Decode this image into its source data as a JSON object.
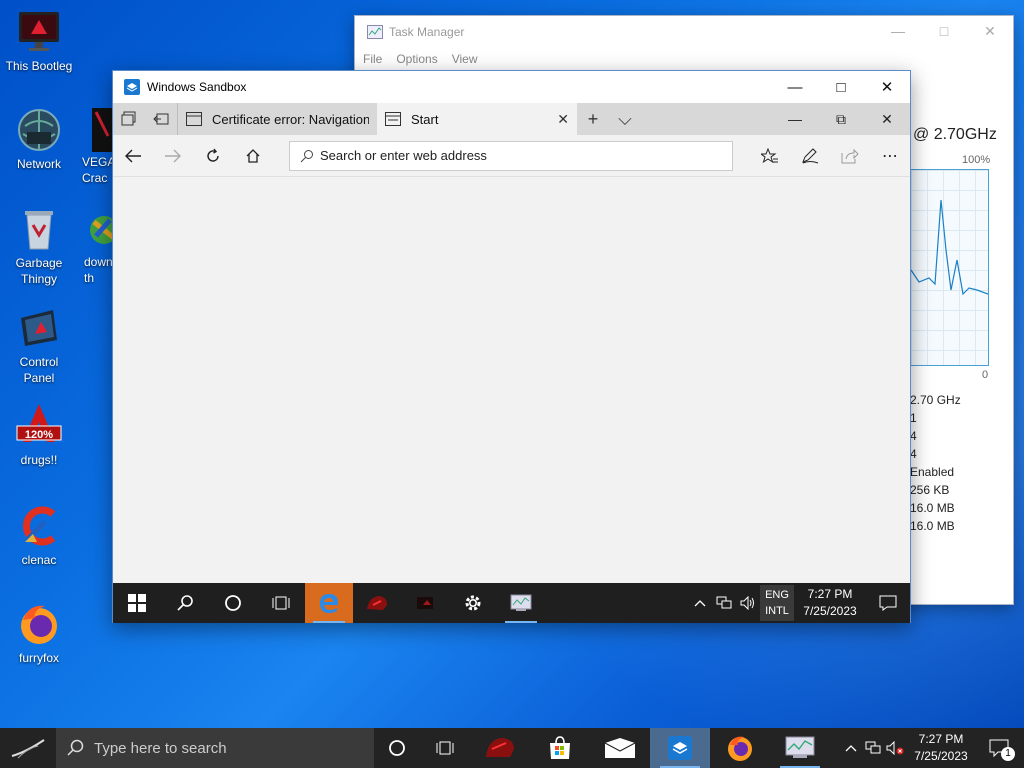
{
  "desktop": {
    "icons": [
      {
        "label": "This Bootleg"
      },
      {
        "label": "Network"
      },
      {
        "label": "VEGA\nCrac"
      },
      {
        "label": "Garbage\nThingy"
      },
      {
        "label": "down\nth"
      },
      {
        "label": "Control\nPanel"
      },
      {
        "label": "drugs!!"
      },
      {
        "label": "clenac"
      },
      {
        "label": "furryfox"
      }
    ],
    "drugs_badge": "120%"
  },
  "task_manager": {
    "title": "Task Manager",
    "menu": [
      "File",
      "Options",
      "View"
    ],
    "cpu_speed_heading": "@ 2.70GHz",
    "graph_max_label": "100%",
    "graph_min_label": "0",
    "stats": [
      "2.70 GHz",
      "1",
      "4",
      "4",
      "Enabled",
      "256 KB",
      "16.0 MB",
      "16.0 MB"
    ]
  },
  "sandbox": {
    "title": "Windows Sandbox"
  },
  "edge": {
    "tabs": [
      {
        "label": "Certificate error: Navigation"
      },
      {
        "label": "Start"
      }
    ],
    "address_placeholder": "Search or enter web address"
  },
  "inner_taskbar": {
    "lang_line1": "ENG",
    "lang_line2": "INTL",
    "time": "7:27 PM",
    "date": "7/25/2023"
  },
  "taskbar": {
    "search_placeholder": "Type here to search",
    "time": "7:27 PM",
    "date": "7/25/2023",
    "notification_count": "1"
  },
  "colors": {
    "accent": "#0078d7",
    "graph_line": "#4aa0d8",
    "edge_highlight": "#d96b1e"
  }
}
